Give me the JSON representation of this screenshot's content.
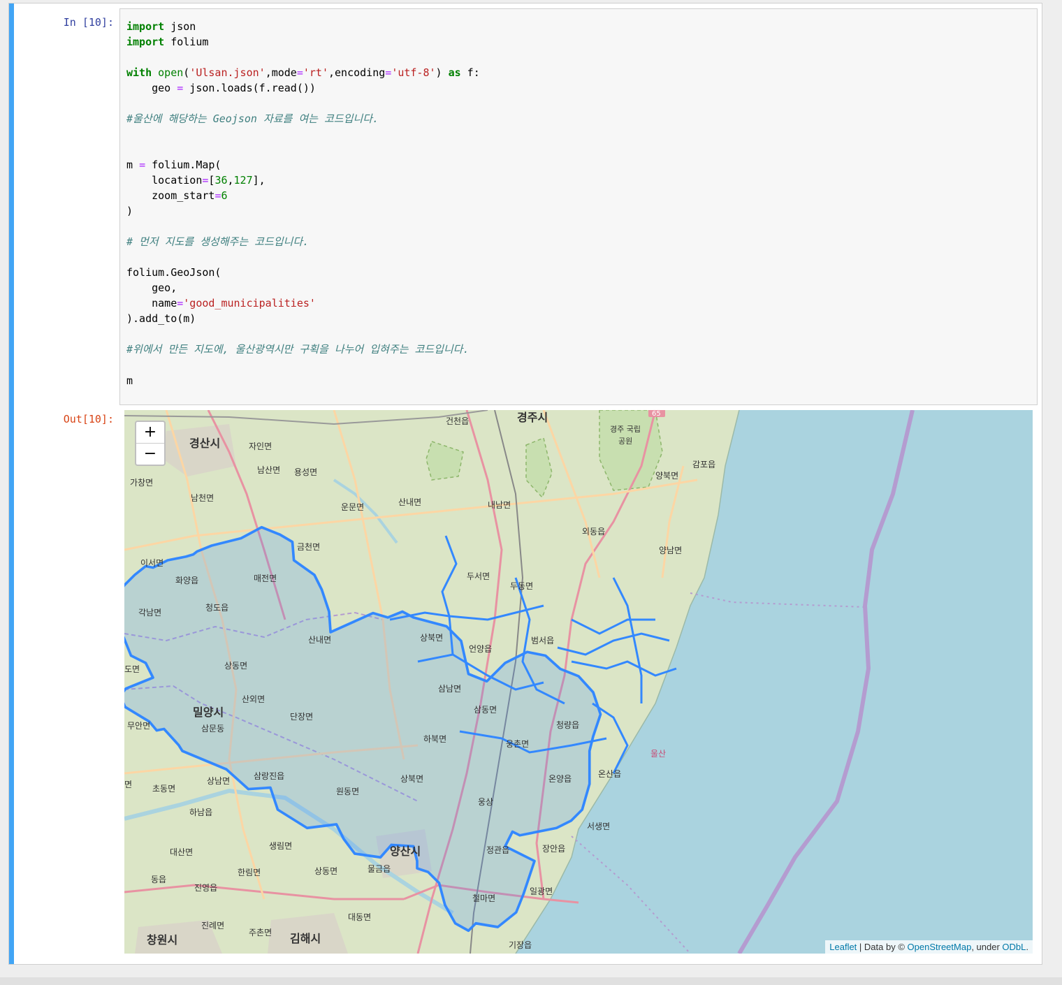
{
  "input_prompt": "In [10]:",
  "output_prompt": "Out[10]:",
  "code": {
    "l1": {
      "k": "import",
      "t": " json"
    },
    "l2": {
      "k": "import",
      "t": " folium"
    },
    "l3": {
      "k": "with",
      "fn": "open",
      "p1": "(",
      "s1": "'Ulsan.json'",
      "p2": ",mode",
      "o1": "=",
      "s2": "'rt'",
      "p3": ",encoding",
      "o2": "=",
      "s3": "'utf-8'",
      "p4": ") ",
      "k2": "as",
      "p5": " f:"
    },
    "l4": {
      "a": "    geo ",
      "o": "=",
      "b": " json.loads(f.read())"
    },
    "c1": "#울산에 해당하는 Geojson 자료를 여는 코드입니다.",
    "l5": {
      "a": "m ",
      "o": "=",
      "b": " folium.Map("
    },
    "l6": {
      "a": "    location",
      "o": "=",
      "b": "[",
      "n1": "36",
      "c": ",",
      "n2": "127",
      "d": "],"
    },
    "l7": {
      "a": "    zoom_start",
      "o": "=",
      "n": "6"
    },
    "l8": ")",
    "c2": "# 먼저 지도를 생성해주는 코드입니다.",
    "l9": "folium.GeoJson(",
    "l10": "    geo,",
    "l11": {
      "a": "    name",
      "o": "=",
      "s": "'good_municipalities'"
    },
    "l12": ").add_to(m)",
    "c3": "#위에서 만든 지도에, 울산광역시만 구획을 나누어 입혀주는 코드입니다.",
    "l13": "m"
  },
  "map": {
    "zoom_in": "+",
    "zoom_out": "−",
    "attribution": {
      "leaflet": "Leaflet",
      "mid": " | Data by © ",
      "osm": "OpenStreetMap",
      "under": ", under ",
      "odbl": "ODbL",
      "end": "."
    },
    "highway_badge": "65",
    "labels": {
      "gyeongju": "경주시",
      "geoncheon": "건천읍",
      "gyeongju_park": "경주 국립",
      "park2": "공원",
      "gampo": "감포읍",
      "yangbuk": "양북면",
      "gyeongsan": "경산시",
      "jain": "자인면",
      "namsan": "남산면",
      "yongseong": "용성면",
      "gachang": "가창면",
      "namcheon": "남천면",
      "unmun": "운문면",
      "sannae1": "산내면",
      "naenam": "내남면",
      "oedong": "외동읍",
      "yangnam": "양남면",
      "geumcheon": "금천면",
      "iseo": "이서면",
      "hwayang": "화양읍",
      "maejeon": "매전면",
      "duseo": "두서면",
      "dudong": "두동면",
      "gaknam": "각남면",
      "cheongdo": "청도읍",
      "sangbuk1": "상북면",
      "sannae2": "산내면",
      "eonyang": "언양읍",
      "beomseo": "범서읍",
      "sangdong1": "상동면",
      "do": "도면",
      "sanoe": "산외면",
      "samnam": "삼남면",
      "milyang": "밀양시",
      "samdong": "삼동면",
      "danjang": "단장면",
      "muan": "무안면",
      "sammun": "삼문동",
      "cheongnyang": "청량읍",
      "habuk": "하북면",
      "ungchon": "웅촌면",
      "ulsan": "울산",
      "onsan": "온산읍",
      "onyang": "온양읍",
      "sangbuk2": "상북면",
      "samrangjin": "삼랑진읍",
      "chodong": "초동면",
      "sangnam": "상남면",
      "wondong": "원동면",
      "myeon": "면",
      "ungsang": "웅상",
      "hanam": "하남읍",
      "seosaeng": "서생면",
      "saengnim": "생림면",
      "yangsan": "양산시",
      "jeonggwan": "정관읍",
      "jangan": "장안읍",
      "daesan": "대산면",
      "hallim": "한림면",
      "sangdong2": "상동면",
      "mulgeum": "물금읍",
      "dong": "동읍",
      "jinyeong": "진영읍",
      "cheolma": "철마면",
      "ilgwang": "일광면",
      "daedong": "대동면",
      "jillye": "진례면",
      "juchon": "주촌면",
      "changwon": "창원시",
      "gimhae": "김해시",
      "gijang": "기장읍"
    }
  }
}
